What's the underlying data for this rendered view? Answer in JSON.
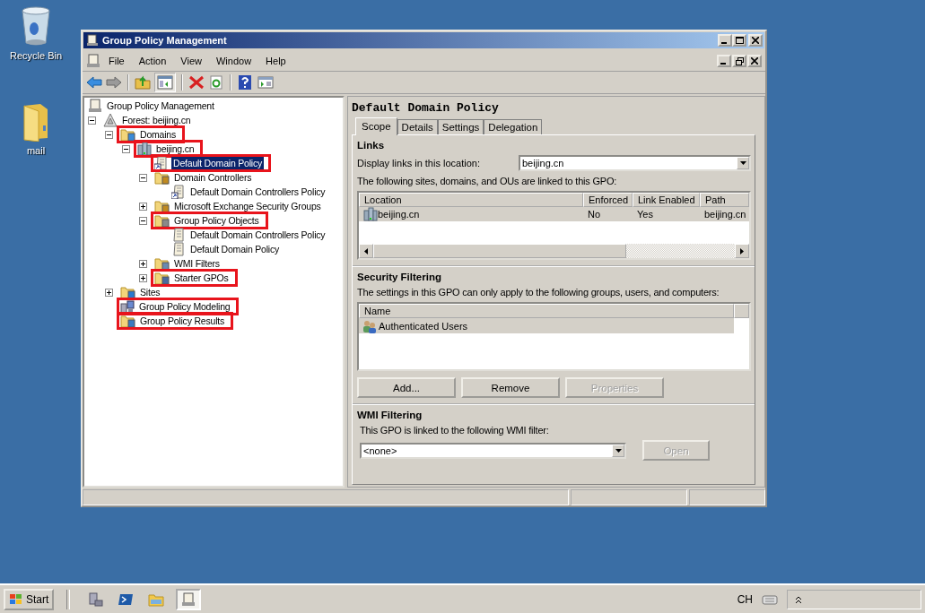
{
  "desktop_icons": [
    {
      "label": "Recycle Bin",
      "kind": "recycle"
    },
    {
      "label": "mail",
      "kind": "folder"
    }
  ],
  "window": {
    "title": "Group Policy Management"
  },
  "menu": [
    "File",
    "Action",
    "View",
    "Window",
    "Help"
  ],
  "tree": [
    {
      "label": "Group Policy Management",
      "kind": "console",
      "selected": false,
      "marked": false,
      "children": [
        {
          "label": "Forest: beijing.cn",
          "kind": "forest",
          "expanded": true,
          "selected": false,
          "marked": false,
          "children": [
            {
              "label": "Domains",
              "kind": "domains",
              "expanded": true,
              "selected": false,
              "marked": true,
              "children": [
                {
                  "label": "beijing.cn",
                  "kind": "domain",
                  "expanded": true,
                  "selected": false,
                  "marked": true,
                  "children": [
                    {
                      "label": "Default Domain Policy",
                      "kind": "gpo-link",
                      "selected": true,
                      "marked": true
                    },
                    {
                      "label": "Domain Controllers",
                      "kind": "ou",
                      "expanded": true,
                      "selected": false,
                      "marked": false,
                      "children": [
                        {
                          "label": "Default Domain Controllers Policy",
                          "kind": "gpo-link",
                          "selected": false,
                          "marked": false
                        }
                      ]
                    },
                    {
                      "label": "Microsoft Exchange Security Groups",
                      "kind": "ou",
                      "expanded": false,
                      "selected": false,
                      "marked": false
                    },
                    {
                      "label": "Group Policy Objects",
                      "kind": "gpo-folder",
                      "expanded": true,
                      "selected": false,
                      "marked": true,
                      "children": [
                        {
                          "label": "Default Domain Controllers Policy",
                          "kind": "gpo",
                          "selected": false,
                          "marked": false
                        },
                        {
                          "label": "Default Domain Policy",
                          "kind": "gpo",
                          "selected": false,
                          "marked": false
                        }
                      ]
                    },
                    {
                      "label": "WMI Filters",
                      "kind": "wmi",
                      "expanded": false,
                      "selected": false,
                      "marked": false
                    },
                    {
                      "label": "Starter GPOs",
                      "kind": "starter",
                      "expanded": false,
                      "selected": false,
                      "marked": true
                    }
                  ]
                }
              ]
            },
            {
              "label": "Sites",
              "kind": "sites",
              "expanded": false,
              "selected": false,
              "marked": false
            },
            {
              "label": "Group Policy Modeling",
              "kind": "modeling",
              "selected": false,
              "marked": true
            },
            {
              "label": "Group Policy Results",
              "kind": "results",
              "selected": false,
              "marked": true
            }
          ]
        }
      ]
    }
  ],
  "details": {
    "title": "Default Domain Policy",
    "tabs": [
      {
        "label": "Scope",
        "selected": true
      },
      {
        "label": "Details",
        "selected": false
      },
      {
        "label": "Settings",
        "selected": false
      },
      {
        "label": "Delegation",
        "selected": false
      }
    ],
    "links": {
      "heading": "Links",
      "location_label": "Display links in this location:",
      "location_value": "beijing.cn",
      "caption": "The following sites, domains, and OUs are linked to this GPO:",
      "columns": [
        "Location",
        "Enforced",
        "Link Enabled",
        "Path"
      ],
      "rows": [
        {
          "cells": [
            "beijing.cn",
            "No",
            "Yes",
            "beijing.cn"
          ],
          "selected": true
        }
      ]
    },
    "security": {
      "heading": "Security Filtering",
      "caption": "The settings in this GPO can only apply to the following groups, users, and computers:",
      "columns": [
        "Name"
      ],
      "rows": [
        {
          "name": "Authenticated Users",
          "selected": true
        }
      ],
      "buttons": [
        {
          "label": "Add...",
          "disabled": false
        },
        {
          "label": "Remove",
          "disabled": false
        },
        {
          "label": "Properties",
          "disabled": true
        }
      ]
    },
    "wmi": {
      "heading": "WMI Filtering",
      "caption": "This GPO is linked to the following WMI filter:",
      "value": "<none>",
      "button": {
        "label": "Open",
        "disabled": true
      }
    }
  },
  "taskbar": {
    "start": "Start",
    "language": "CH",
    "tasks": [
      {
        "kind": "server",
        "active": false
      },
      {
        "kind": "powershell",
        "active": false
      },
      {
        "kind": "explorer",
        "active": false
      },
      {
        "kind": "console",
        "active": true
      }
    ]
  }
}
